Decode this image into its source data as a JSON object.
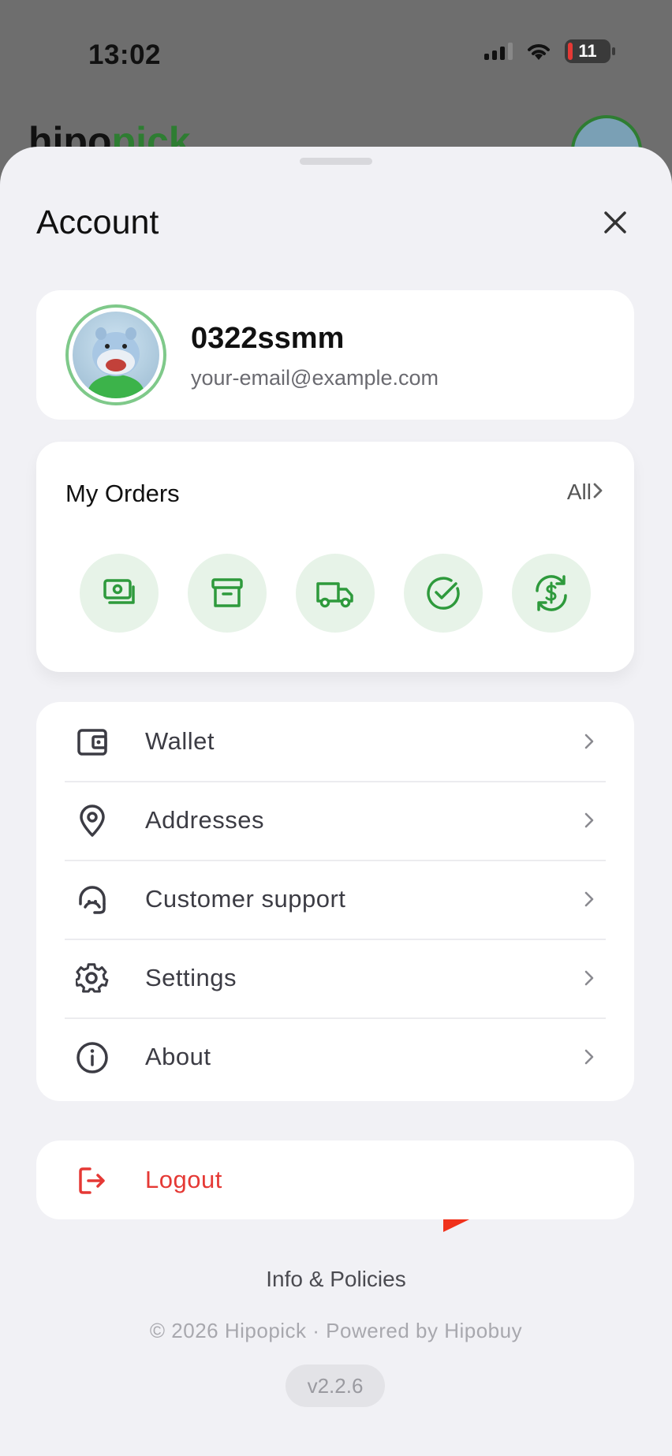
{
  "status_bar": {
    "time": "13:02",
    "battery": "11"
  },
  "background": {
    "logo_dark": "hipo",
    "logo_green": "pick"
  },
  "sheet": {
    "title": "Account"
  },
  "profile": {
    "username": "0322ssmm",
    "email": "your-email@example.com"
  },
  "orders": {
    "title": "My Orders",
    "all_label": "All",
    "status_icons": [
      "pending-payment-icon",
      "packaged-box-icon",
      "shipping-truck-icon",
      "completed-check-icon",
      "refund-exchange-icon"
    ]
  },
  "menu": {
    "items": [
      {
        "label": "Wallet",
        "icon": "wallet-icon"
      },
      {
        "label": "Addresses",
        "icon": "location-pin-icon"
      },
      {
        "label": "Customer support",
        "icon": "headset-icon"
      },
      {
        "label": "Settings",
        "icon": "gear-icon"
      },
      {
        "label": "About",
        "icon": "info-icon"
      }
    ]
  },
  "logout": {
    "label": "Logout",
    "icon": "logout-icon"
  },
  "footer": {
    "info_link": "Info & Policies",
    "copyright": "© 2026 Hipopick · Powered by Hipobuy",
    "version": "v2.2.6"
  },
  "colors": {
    "accent_green": "#2e9a3c",
    "danger_red": "#e53935",
    "annotation_arrow": "#f0311b"
  }
}
